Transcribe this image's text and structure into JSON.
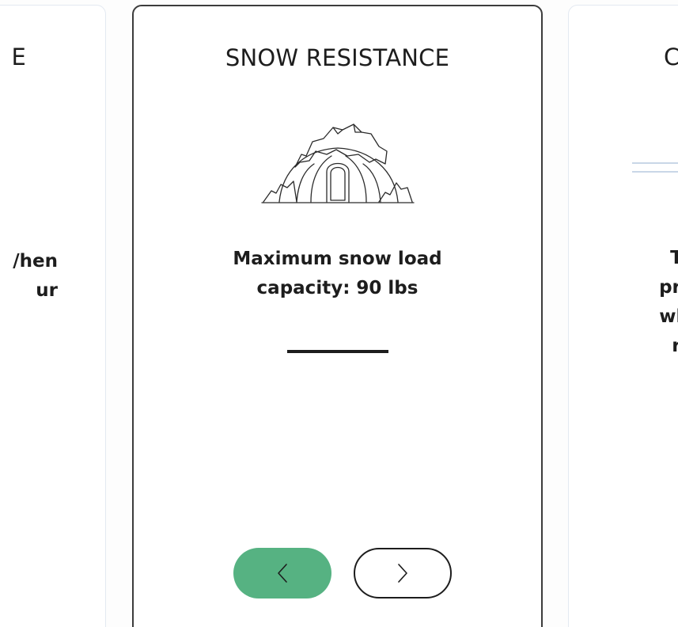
{
  "cards": [
    {
      "title": "E",
      "body_lines": [
        "/hen",
        "ur"
      ]
    },
    {
      "title": "SNOW RESISTANCE",
      "icon": "snow-covered-tent-icon",
      "body_lines": [
        "Maximum snow load",
        "capacity: 90 lbs"
      ]
    },
    {
      "title": "C",
      "body_lines": [
        "The",
        "practi",
        "which",
        "req"
      ]
    }
  ],
  "navigation": {
    "prev_icon": "chevron-left-icon",
    "next_icon": "chevron-right-icon",
    "prev_label": "‹",
    "next_label": "›"
  },
  "colors": {
    "accent": "#56b282",
    "text": "#1d1d1d",
    "active_border": "#3c3c3c",
    "inactive_border": "#e3e9f1"
  }
}
